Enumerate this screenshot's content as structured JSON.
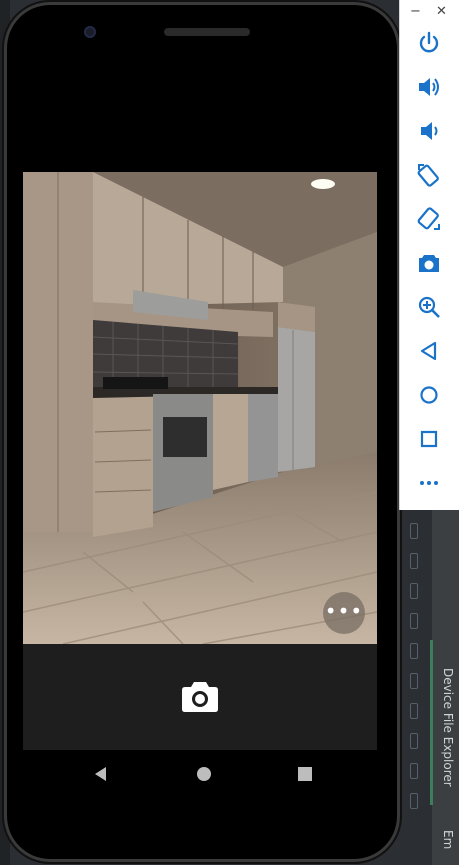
{
  "emulator_panel": {
    "minimize_label": "−",
    "close_label": "✕",
    "buttons": [
      {
        "name": "power",
        "icon": "power-icon"
      },
      {
        "name": "volume-up",
        "icon": "volume-up-icon"
      },
      {
        "name": "volume-down",
        "icon": "volume-down-icon"
      },
      {
        "name": "rotate-left",
        "icon": "rotate-left-icon"
      },
      {
        "name": "rotate-right",
        "icon": "rotate-right-icon"
      },
      {
        "name": "screenshot",
        "icon": "camera-icon"
      },
      {
        "name": "zoom",
        "icon": "zoom-in-icon"
      },
      {
        "name": "back",
        "icon": "back-icon"
      },
      {
        "name": "home",
        "icon": "home-icon"
      },
      {
        "name": "overview",
        "icon": "square-icon"
      },
      {
        "name": "more",
        "icon": "more-icon"
      }
    ],
    "accent_color": "#1a73c8"
  },
  "camera_app": {
    "more_label": "•••",
    "shutter_icon": "camera-icon",
    "preview_scene": "kitchen"
  },
  "nav_bar": {
    "back_icon": "triangle-back-icon",
    "home_icon": "circle-home-icon",
    "recents_icon": "square-recents-icon"
  },
  "ide": {
    "tool_window_label": "Device File Explorer",
    "tool_window_label_2": "Em"
  }
}
